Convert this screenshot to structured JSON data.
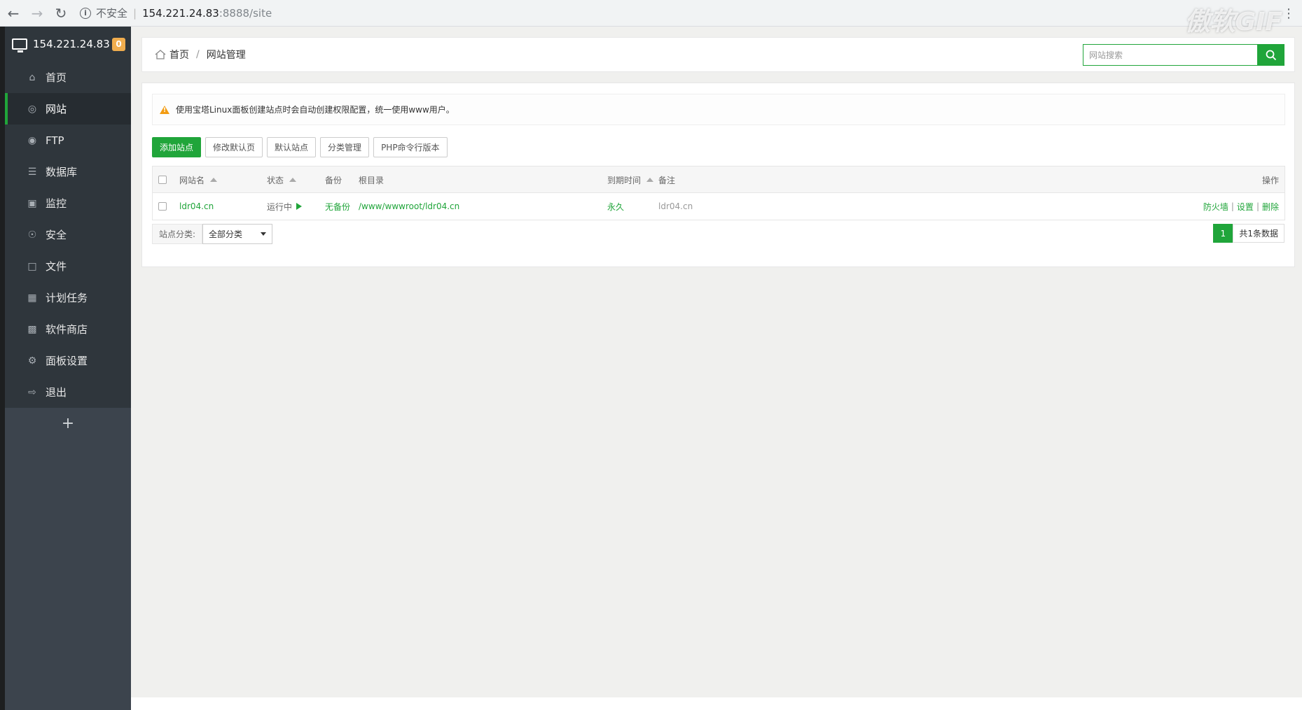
{
  "browser": {
    "security_label": "不安全",
    "url_host": "154.221.24.83",
    "url_port_path": ":8888/site",
    "watermark": "傲软GIF"
  },
  "sidebar": {
    "ip": "154.221.24.83",
    "badge_count": "0",
    "items": [
      {
        "label": "首页",
        "icon": "home-icon"
      },
      {
        "label": "网站",
        "icon": "globe-icon"
      },
      {
        "label": "FTP",
        "icon": "ftp-icon"
      },
      {
        "label": "数据库",
        "icon": "database-icon"
      },
      {
        "label": "监控",
        "icon": "monitor-icon"
      },
      {
        "label": "安全",
        "icon": "shield-icon"
      },
      {
        "label": "文件",
        "icon": "folder-icon"
      },
      {
        "label": "计划任务",
        "icon": "calendar-icon"
      },
      {
        "label": "软件商店",
        "icon": "grid-icon"
      },
      {
        "label": "面板设置",
        "icon": "gear-icon"
      },
      {
        "label": "退出",
        "icon": "logout-icon"
      }
    ],
    "add_label": "+"
  },
  "breadcrumb": {
    "home": "首页",
    "separator": "/",
    "current": "网站管理"
  },
  "search": {
    "placeholder": "网站搜索"
  },
  "alert": {
    "text": "使用宝塔Linux面板创建站点时会自动创建权限配置，统一使用www用户。"
  },
  "toolbar": {
    "add_site": "添加站点",
    "modify_default_page": "修改默认页",
    "default_site": "默认站点",
    "category_manage": "分类管理",
    "php_cli_version": "PHP命令行版本"
  },
  "table": {
    "headers": {
      "name": "网站名",
      "status": "状态",
      "backup": "备份",
      "root": "根目录",
      "expire": "到期时间",
      "note": "备注",
      "ops": "操作"
    },
    "rows": [
      {
        "name": "ldr04.cn",
        "status": "运行中",
        "backup": "无备份",
        "root": "/www/wwwroot/ldr04.cn",
        "expire": "永久",
        "note": "ldr04.cn",
        "op_firewall": "防火墙",
        "op_settings": "设置",
        "op_delete": "删除",
        "op_sep": "|"
      }
    ]
  },
  "category": {
    "label": "站点分类:",
    "selected": "全部分类"
  },
  "pager": {
    "current_page": "1",
    "total": "共1条数据"
  },
  "colors": {
    "accent": "#20a53a",
    "sidebar_bg": "#3c444d",
    "badge": "#f0ad4e"
  }
}
